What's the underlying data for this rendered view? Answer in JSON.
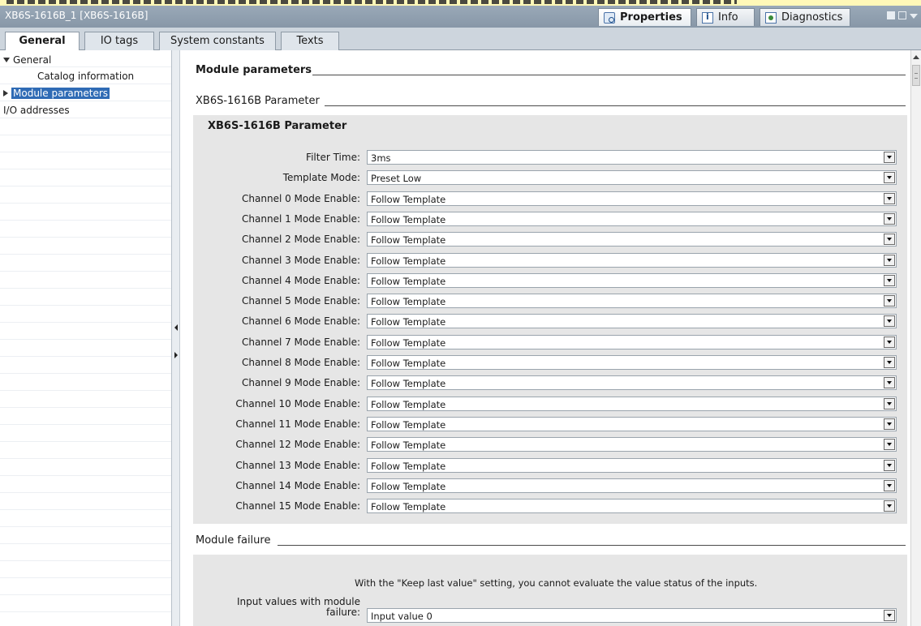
{
  "window": {
    "title": "XB6S-1616B_1 [XB6S-1616B]",
    "inspector_tabs": [
      {
        "label": "Properties",
        "icon": "properties-icon",
        "active": true
      },
      {
        "label": "Info",
        "icon": "info-icon",
        "active": false
      },
      {
        "label": "Diagnostics",
        "icon": "diagnostics-icon",
        "active": false
      }
    ]
  },
  "tabs": [
    {
      "label": "General",
      "active": true
    },
    {
      "label": "IO tags",
      "active": false
    },
    {
      "label": "System constants",
      "active": false
    },
    {
      "label": "Texts",
      "active": false
    }
  ],
  "nav": {
    "items": [
      {
        "label": "General",
        "expanded": true
      },
      {
        "label": "Catalog information"
      },
      {
        "label": "Module parameters",
        "selected": true
      },
      {
        "label": "I/O addresses"
      }
    ]
  },
  "content": {
    "module_parameters_heading": "Module parameters",
    "sub_heading": "XB6S-1616B Parameter",
    "group_title": "XB6S-1616B Parameter",
    "params": [
      {
        "label": "Filter Time:",
        "value": "3ms"
      },
      {
        "label": "Template Mode:",
        "value": "Preset Low"
      },
      {
        "label": "Channel 0 Mode Enable:",
        "value": "Follow Template"
      },
      {
        "label": "Channel 1 Mode Enable:",
        "value": "Follow Template"
      },
      {
        "label": "Channel 2 Mode Enable:",
        "value": "Follow Template"
      },
      {
        "label": "Channel 3 Mode Enable:",
        "value": "Follow Template"
      },
      {
        "label": "Channel 4 Mode Enable:",
        "value": "Follow Template"
      },
      {
        "label": "Channel 5 Mode Enable:",
        "value": "Follow Template"
      },
      {
        "label": "Channel 6 Mode Enable:",
        "value": "Follow Template"
      },
      {
        "label": "Channel 7 Mode Enable:",
        "value": "Follow Template"
      },
      {
        "label": "Channel 8 Mode Enable:",
        "value": "Follow Template"
      },
      {
        "label": "Channel 9 Mode Enable:",
        "value": "Follow Template"
      },
      {
        "label": "Channel 10 Mode Enable:",
        "value": "Follow Template"
      },
      {
        "label": "Channel 11 Mode Enable:",
        "value": "Follow Template"
      },
      {
        "label": "Channel 12 Mode Enable:",
        "value": "Follow Template"
      },
      {
        "label": "Channel 13 Mode Enable:",
        "value": "Follow Template"
      },
      {
        "label": "Channel 14 Mode Enable:",
        "value": "Follow Template"
      },
      {
        "label": "Channel 15 Mode Enable:",
        "value": "Follow Template"
      }
    ],
    "module_failure_heading": "Module failure",
    "failure_info": "With the \"Keep last value\" setting, you cannot evaluate the value status of the inputs.",
    "failure_label_line1": "Input values with module",
    "failure_label_line2": "failure:",
    "failure_value": "Input value 0"
  }
}
